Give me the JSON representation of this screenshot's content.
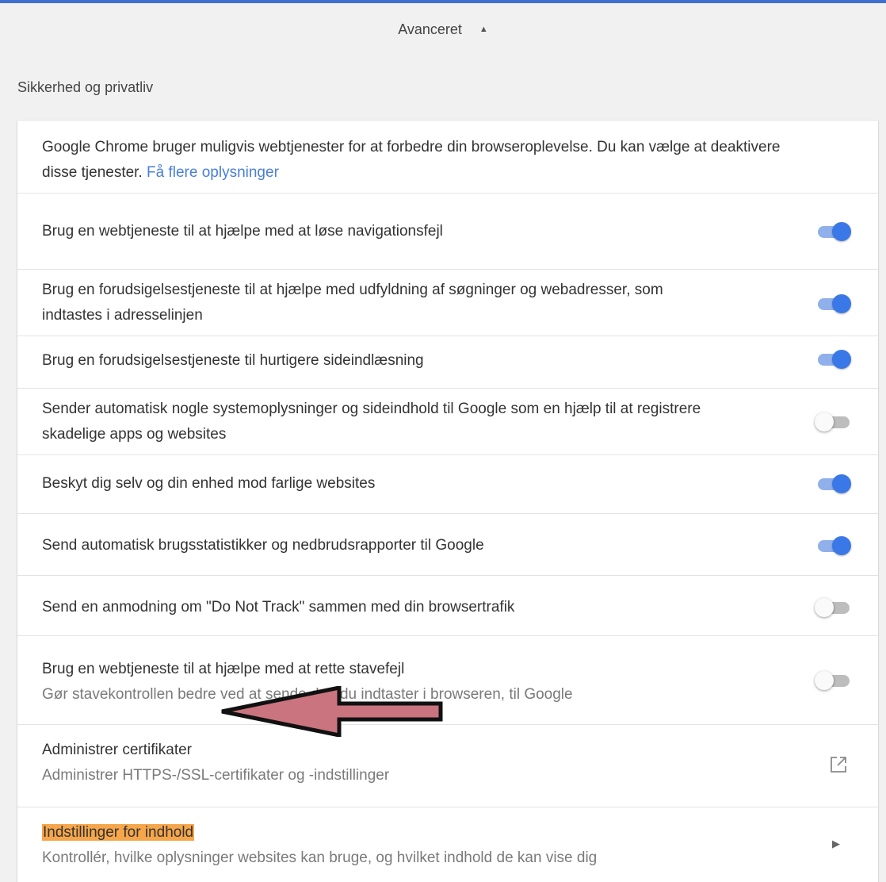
{
  "advanced": {
    "label": "Avanceret",
    "caret": "▲"
  },
  "section": {
    "title": "Sikkerhed og privatliv"
  },
  "intro": {
    "text_line1": "Google Chrome bruger muligvis webtjenester for at forbedre din browseroplevelse. Du kan vælge at deaktivere",
    "text_line2": "disse tjenester.",
    "link": "Få flere oplysninger"
  },
  "toggles": [
    {
      "line1": "Brug en webtjeneste til at hjælpe med at løse navigationsfejl",
      "line2": "",
      "on": true
    },
    {
      "line1": "Brug en forudsigelsestjeneste til at hjælpe med udfyldning af søgninger og webadresser, som",
      "line2": "indtastes i adresselinjen",
      "on": true
    },
    {
      "line1": "Brug en forudsigelsestjeneste til hurtigere sideindlæsning",
      "line2": "",
      "on": true
    },
    {
      "line1": "Sender automatisk nogle systemoplysninger og sideindhold til Google som en hjælp til at registrere",
      "line2": "skadelige apps og websites",
      "on": false
    },
    {
      "line1": "Beskyt dig selv og din enhed mod farlige websites",
      "line2": "",
      "on": true
    },
    {
      "line1": "Send automatisk brugsstatistikker og nedbrudsrapporter til Google",
      "line2": "",
      "on": true
    },
    {
      "line1": "Send en anmodning om \"Do Not Track\" sammen med din browsertrafik",
      "line2": "",
      "on": false
    },
    {
      "line1": "Brug en webtjeneste til at hjælpe med at rette stavefejl",
      "line2": "Gør stavekontrollen bedre ved at sende det, du indtaster i browseren, til Google",
      "on": false
    }
  ],
  "certificates": {
    "title": "Administrer certifikater",
    "subtitle": "Administrer HTTPS-/SSL-certifikater og -indstillinger",
    "icon": "external-link-icon"
  },
  "content_settings": {
    "title": "Indstillinger for indhold",
    "subtitle": "Kontrollér, hvilke oplysninger websites kan bruge, og hvilket indhold de kan vise dig",
    "icon": "chevron-right-icon"
  },
  "colors": {
    "accent": "#3b78e7",
    "highlight": "#f6a64a",
    "arrow": "#c9747e"
  }
}
